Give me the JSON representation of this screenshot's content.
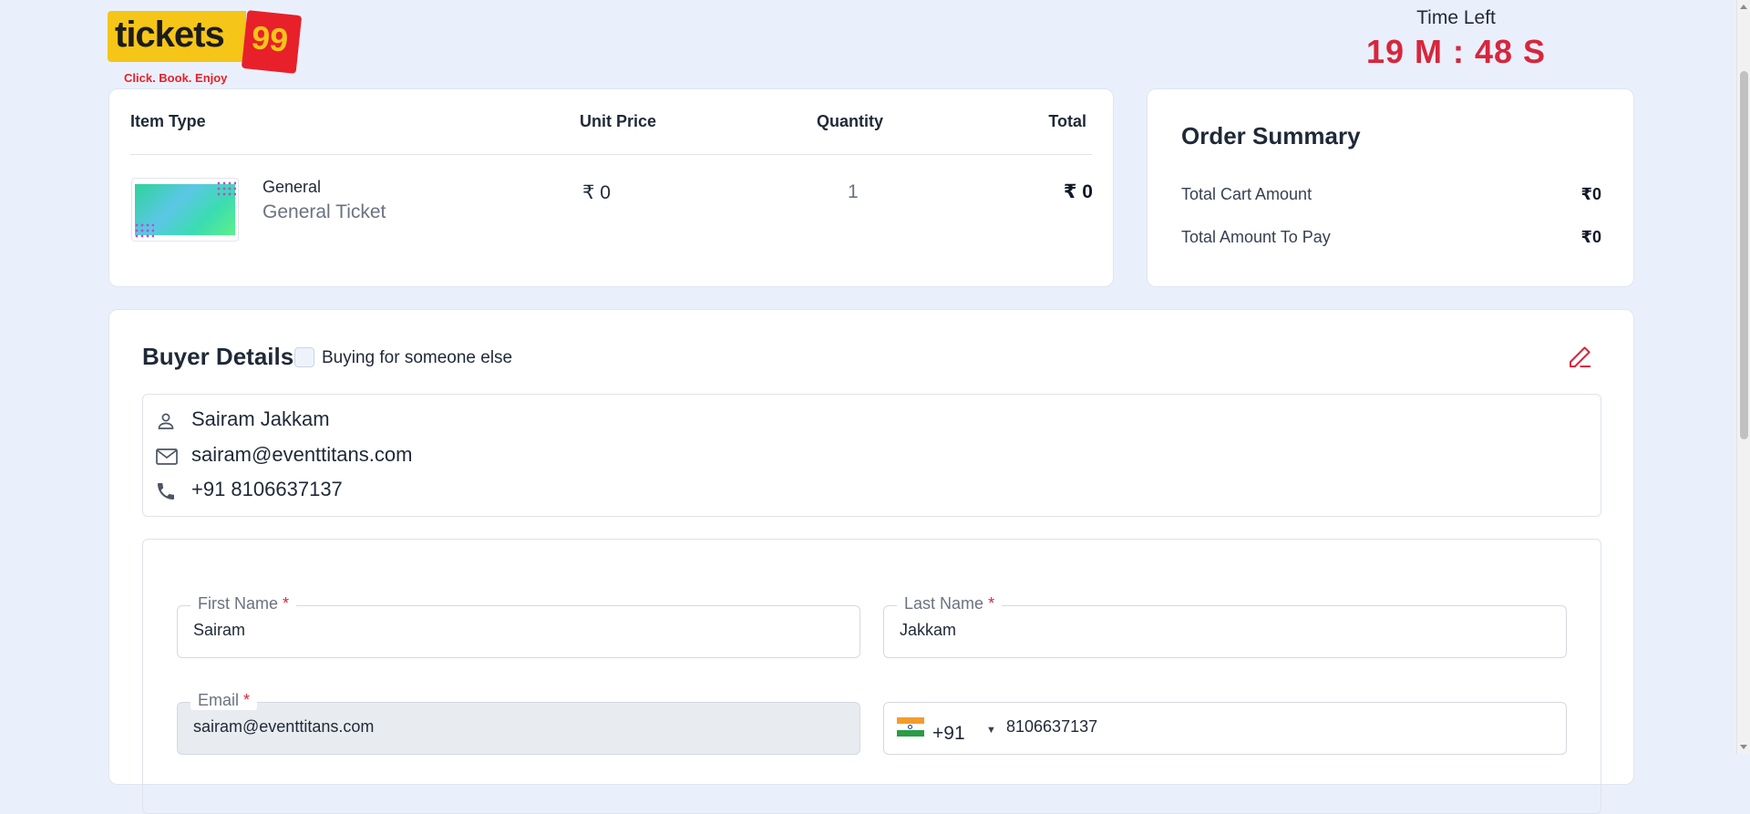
{
  "logo": {
    "word": "tickets",
    "number": "99",
    "tagline": "Click. Book. Enjoy"
  },
  "timer": {
    "label": "Time Left",
    "value": "19 M : 48 S",
    "color": "#d7263d"
  },
  "cart": {
    "headers": {
      "item_type": "Item Type",
      "unit_price": "Unit Price",
      "quantity": "Quantity",
      "total": "Total"
    },
    "items": [
      {
        "category": "General",
        "name": "General Ticket",
        "unit_price": "₹ 0",
        "quantity": "1",
        "total": "₹ 0"
      }
    ]
  },
  "summary": {
    "title": "Order Summary",
    "rows": [
      {
        "label": "Total Cart Amount",
        "value": "₹0"
      },
      {
        "label": "Total Amount To Pay",
        "value": "₹0"
      }
    ]
  },
  "buyer": {
    "title": "Buyer Details",
    "someone_else_label": "Buying for someone else",
    "someone_else_checked": false,
    "name": "Sairam Jakkam",
    "email": "sairam@eventtitans.com",
    "phone": "+91 8106637137",
    "form": {
      "first_name": {
        "label": "First Name",
        "required_mark": "*",
        "value": "Sairam"
      },
      "last_name": {
        "label": "Last Name",
        "required_mark": "*",
        "value": "Jakkam"
      },
      "email": {
        "label": "Email",
        "required_mark": "*",
        "value": "sairam@eventtitans.com",
        "disabled": true
      },
      "phone": {
        "country_flag": "india-flag-icon",
        "country_code": "+91",
        "value": "8106637137"
      }
    }
  },
  "colors": {
    "background": "#eaf0fb",
    "accent_red": "#d7263d",
    "logo_yellow": "#f5c518",
    "logo_red": "#e8202a"
  }
}
